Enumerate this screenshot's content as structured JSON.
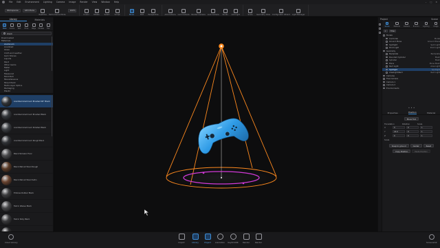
{
  "menubar": {
    "items": [
      "File",
      "Edit",
      "Environment",
      "Lighting",
      "Camera",
      "Image",
      "Render",
      "View",
      "Window",
      "Help"
    ],
    "window_controls": [
      "–",
      "□",
      "×"
    ]
  },
  "toolbar": {
    "workspace_label": "Workspaces",
    "presets_label": "GPU Mode",
    "quality_label": "Realtime",
    "performance_label": "Performance Mode",
    "zoom_value": "100%",
    "buttons": [
      "Cursor",
      "Rotate",
      "Select",
      "Sculpt",
      "Move",
      "Edit",
      "Perspective",
      "Add Camera",
      "Lock Camera",
      "Render Camera",
      "Lock Camera",
      "Studio",
      "Add Light",
      "Scale",
      "Geometry View",
      "Configurator Wizard",
      "Light Manager"
    ]
  },
  "library": {
    "tabs": [
      "Library",
      "Materials"
    ],
    "icons": [
      "Mats",
      "Colors",
      "Text",
      "Envs",
      "Bkgs",
      "Models",
      "Fav"
    ],
    "search_value": "black",
    "folders": [
      "Downloaded",
      "Materials",
      "Aluminum",
      "Anodized",
      "Glass",
      "Cloth and Leather",
      "Gem Stones",
      "Liquids",
      "Paint",
      "Other Gems",
      "Metal",
      "Light",
      "Measured",
      "Mold-Tech",
      "Miscellaneous",
      "Mixed Paint",
      "Multi-Layer Optics",
      "Packaging",
      "Plastic",
      "Real Cloth",
      "Scattering Medium",
      "Stone",
      "Toon",
      "Translucent",
      "Wood"
    ],
    "selected_folder": "Aluminum",
    "materials": [
      {
        "name": "Anodized Aluminum Brushed 90° Black",
        "color": "#2f3236"
      },
      {
        "name": "Anodized Aluminum Brushed Black",
        "color": "#34373b"
      },
      {
        "name": "Anodized Aluminum Polished Black",
        "color": "#3a3d41"
      },
      {
        "name": "Anodized Aluminum Rough Black",
        "color": "#303236"
      },
      {
        "name": "Black Terrazzo Floor",
        "color": "#4a4a4c"
      },
      {
        "name": "Black Walnut Wood Rough",
        "color": "#5a3a26"
      },
      {
        "name": "Black Walnut Wood Satin",
        "color": "#6a4430"
      },
      {
        "name": "Emboss Rubber Black",
        "color": "#3c3c3e"
      },
      {
        "name": "Fabric Weave Black",
        "color": "#454547"
      },
      {
        "name": "Fabric Silky Black",
        "color": "#3a3a3c"
      },
      {
        "name": "Hard Rough Plastic Black",
        "color": "#2c2c2e"
      },
      {
        "name": "Hard Shiny Plastic Black",
        "color": "#202022"
      }
    ],
    "selected_material": "Anodized Aluminum Brushed 90° Black"
  },
  "right_panel": {
    "header_left": "Project",
    "header_right": "Scene",
    "icons": [
      "Scene",
      "Material",
      "Camera",
      "Environ.",
      "Lighting",
      "Image"
    ],
    "active_icon": "Scene",
    "filter_buttons": [
      "▾",
      "Filter"
    ],
    "scene_tree": [
      {
        "name": "Models",
        "type": ""
      },
      {
        "name": "Controller",
        "type": "Model"
      },
      {
        "name": "Ground Plane",
        "type": "Ground Plane"
      },
      {
        "name": "Spotlight",
        "type": "Spot Light"
      },
      {
        "name": "Point Light",
        "type": "Point Light"
      },
      {
        "name": "Geometry",
        "type": ""
      },
      {
        "name": "Backplate",
        "type": "Backplate"
      },
      {
        "name": "Rounded Cylinder",
        "type": "Mesh"
      },
      {
        "name": "Cylinder",
        "type": "Mesh"
      },
      {
        "name": "Plane",
        "type": "Plane Mesh"
      },
      {
        "name": "Rect Light",
        "type": "Area Light"
      },
      {
        "name": "Spotlight",
        "type": "Spotlight"
      },
      {
        "name": "AreaLight/Rect",
        "type": "Rect Light"
      },
      {
        "name": "Cameras",
        "type": ""
      },
      {
        "name": "Free Camera",
        "type": ""
      },
      {
        "name": "Camera 1",
        "type": ""
      },
      {
        "name": "Camera 2",
        "type": ""
      },
      {
        "name": "Environments",
        "type": ""
      }
    ],
    "selected_index": 11,
    "props_tabs": [
      "Properties",
      "Position",
      "Material"
    ],
    "active_props_tab": "Position",
    "move_tool_label": "Move Tool",
    "transform_headers": [
      "Translation",
      "Rotation",
      "Scale"
    ],
    "transform_rows": [
      {
        "axis": "X",
        "t": "0",
        "r": "0",
        "s": "1"
      },
      {
        "axis": "Y",
        "t": "24.0",
        "r": "0",
        "s": "1"
      },
      {
        "axis": "Z",
        "t": "0",
        "r": "0",
        "s": "1"
      }
    ],
    "scale_label": "Scale",
    "buttons_row1": [
      "Snap to ground",
      "Center",
      "Reset"
    ],
    "buttons_row2": [
      "Copy Position",
      "Paste Position"
    ]
  },
  "dock": {
    "items": [
      "Import",
      "Library",
      "Project",
      "Animation",
      "KeyShotXR",
      "Render",
      "Render"
    ],
    "active": "Project",
    "left_label": "Cloud Library",
    "right_label": "Screenshot"
  },
  "colors": {
    "accent": "#3e8ed6",
    "light_cone": "#ff8a1f",
    "selection_ring": "#d23ad8",
    "controller": "#3aa6ea"
  },
  "icons": {
    "app_logo": "app-logo-icon",
    "search": "search-icon",
    "spotlight": "spotlight-icon",
    "controller": "game-controller-model"
  }
}
